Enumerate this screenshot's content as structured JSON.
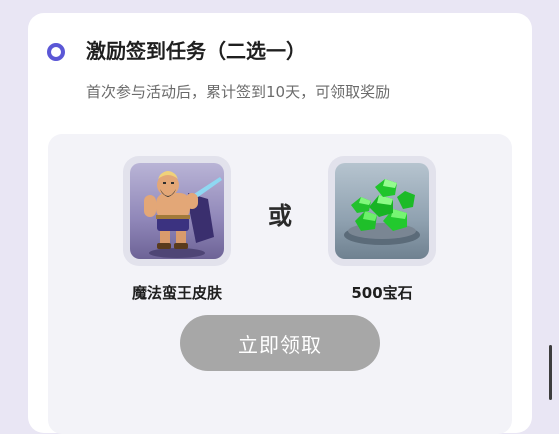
{
  "task": {
    "title": "激励签到任务（二选一）",
    "subtitle": "首次参与活动后，累计签到10天，可领取奖励"
  },
  "rewards": {
    "option_a": {
      "label": "魔法蛮王皮肤"
    },
    "separator": "或",
    "option_b": {
      "label": "500宝石"
    }
  },
  "actions": {
    "claim_label": "立即领取",
    "claim_state": "disabled"
  },
  "colors": {
    "page_background": "#e9e6f4",
    "accent": "#5b57d6",
    "panel_background": "#f3f3f8",
    "button_disabled": "#a7a7a7",
    "gem": "#2bd12b"
  }
}
